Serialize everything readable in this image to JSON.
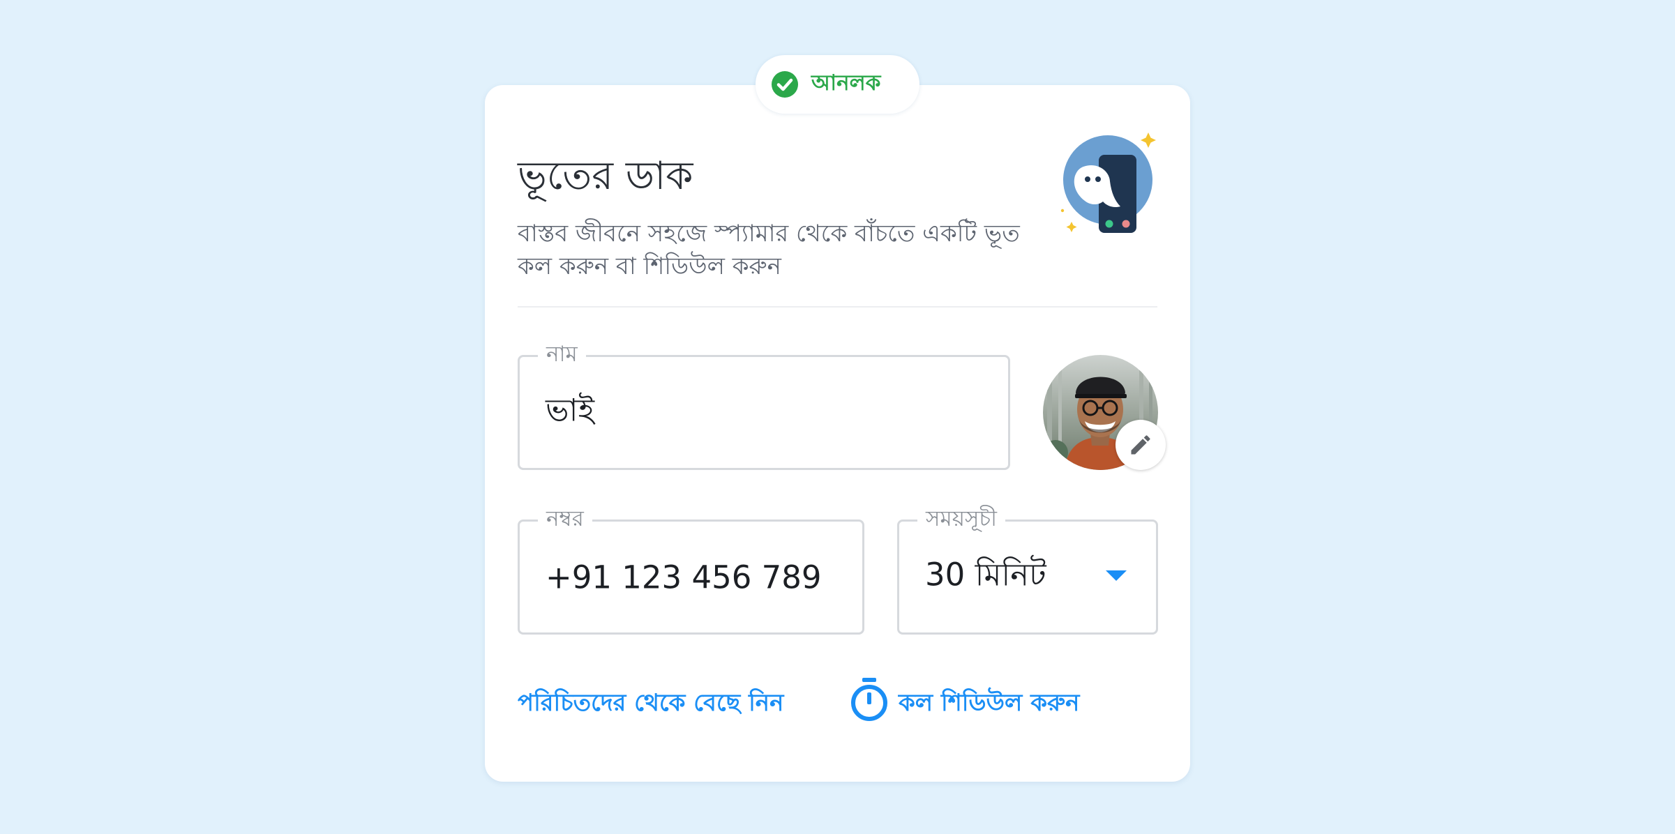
{
  "badge": {
    "label": "আনলক",
    "icon": "check-circle-icon",
    "color": "#2ba84a"
  },
  "header": {
    "title": "ভূতের ডাক",
    "subtitle": "বাস্তব জীবনে সহজে স্প্যামার থেকে বাঁচতে একটি ভূত কল করুন বা শিডিউল করুন",
    "illustration": "ghost-phone-icon"
  },
  "form": {
    "name": {
      "label": "নাম",
      "value": "ভাই"
    },
    "number": {
      "label": "নম্বর",
      "value": "+91 123 456 789"
    },
    "schedule": {
      "label": "সময়সূচী",
      "value": "30 মিনিট"
    }
  },
  "avatar": {
    "icon": "avatar-photo",
    "edit_icon": "pencil-icon"
  },
  "actions": {
    "pick_contacts": "পরিচিতদের থেকে বেছে নিন",
    "schedule_call": "কল শিডিউল করুন",
    "schedule_icon": "stopwatch-icon"
  },
  "colors": {
    "background": "#e1f1fc",
    "accent": "#1a8ef5",
    "success": "#2ba84a"
  }
}
